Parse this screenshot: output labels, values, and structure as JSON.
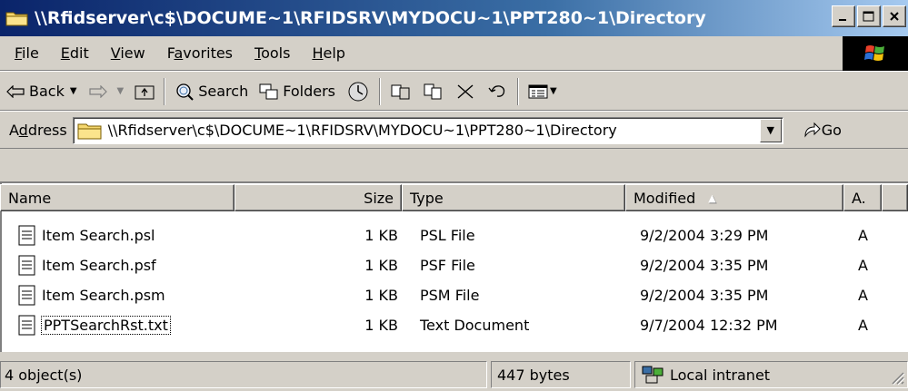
{
  "window": {
    "title": "\\\\Rfidserver\\c$\\DOCUME~1\\RFIDSRV\\MYDOCU~1\\PPT280~1\\Directory",
    "minimize": "_",
    "maximize": "□",
    "close": "×"
  },
  "menu": {
    "file": {
      "pre": "",
      "u": "F",
      "post": "ile"
    },
    "edit": {
      "pre": "",
      "u": "E",
      "post": "dit"
    },
    "view": {
      "pre": "",
      "u": "V",
      "post": "iew"
    },
    "favorites": {
      "pre": "F",
      "u": "a",
      "post": "vorites"
    },
    "tools": {
      "pre": "",
      "u": "T",
      "post": "ools"
    },
    "help": {
      "pre": "",
      "u": "H",
      "post": "elp"
    }
  },
  "toolbar": {
    "back": "Back",
    "search": "Search",
    "folders": "Folders"
  },
  "address": {
    "label_pre": "A",
    "label_u": "d",
    "label_post": "dress",
    "value": "\\\\Rfidserver\\c$\\DOCUME~1\\RFIDSRV\\MYDOCU~1\\PPT280~1\\Directory",
    "go": "Go"
  },
  "columns": {
    "name": "Name",
    "size": "Size",
    "type": "Type",
    "modified": "Modified",
    "attributes": "A."
  },
  "files": [
    {
      "name": "Item Search.psl",
      "size": "1 KB",
      "type": "PSL File",
      "modified": "9/2/2004 3:29 PM",
      "attr": "A"
    },
    {
      "name": "Item Search.psf",
      "size": "1 KB",
      "type": "PSF File",
      "modified": "9/2/2004 3:35 PM",
      "attr": "A"
    },
    {
      "name": "Item Search.psm",
      "size": "1 KB",
      "type": "PSM File",
      "modified": "9/2/2004 3:35 PM",
      "attr": "A"
    },
    {
      "name": "PPTSearchRst.txt",
      "size": "1 KB",
      "type": "Text Document",
      "modified": "9/7/2004 12:32 PM",
      "attr": "A"
    }
  ],
  "status": {
    "objects": "4 object(s)",
    "bytes": "447 bytes",
    "zone": "Local intranet"
  },
  "colors": {
    "title_start": "#0a246a",
    "title_end": "#a6caf0",
    "face": "#d4d0c8"
  }
}
